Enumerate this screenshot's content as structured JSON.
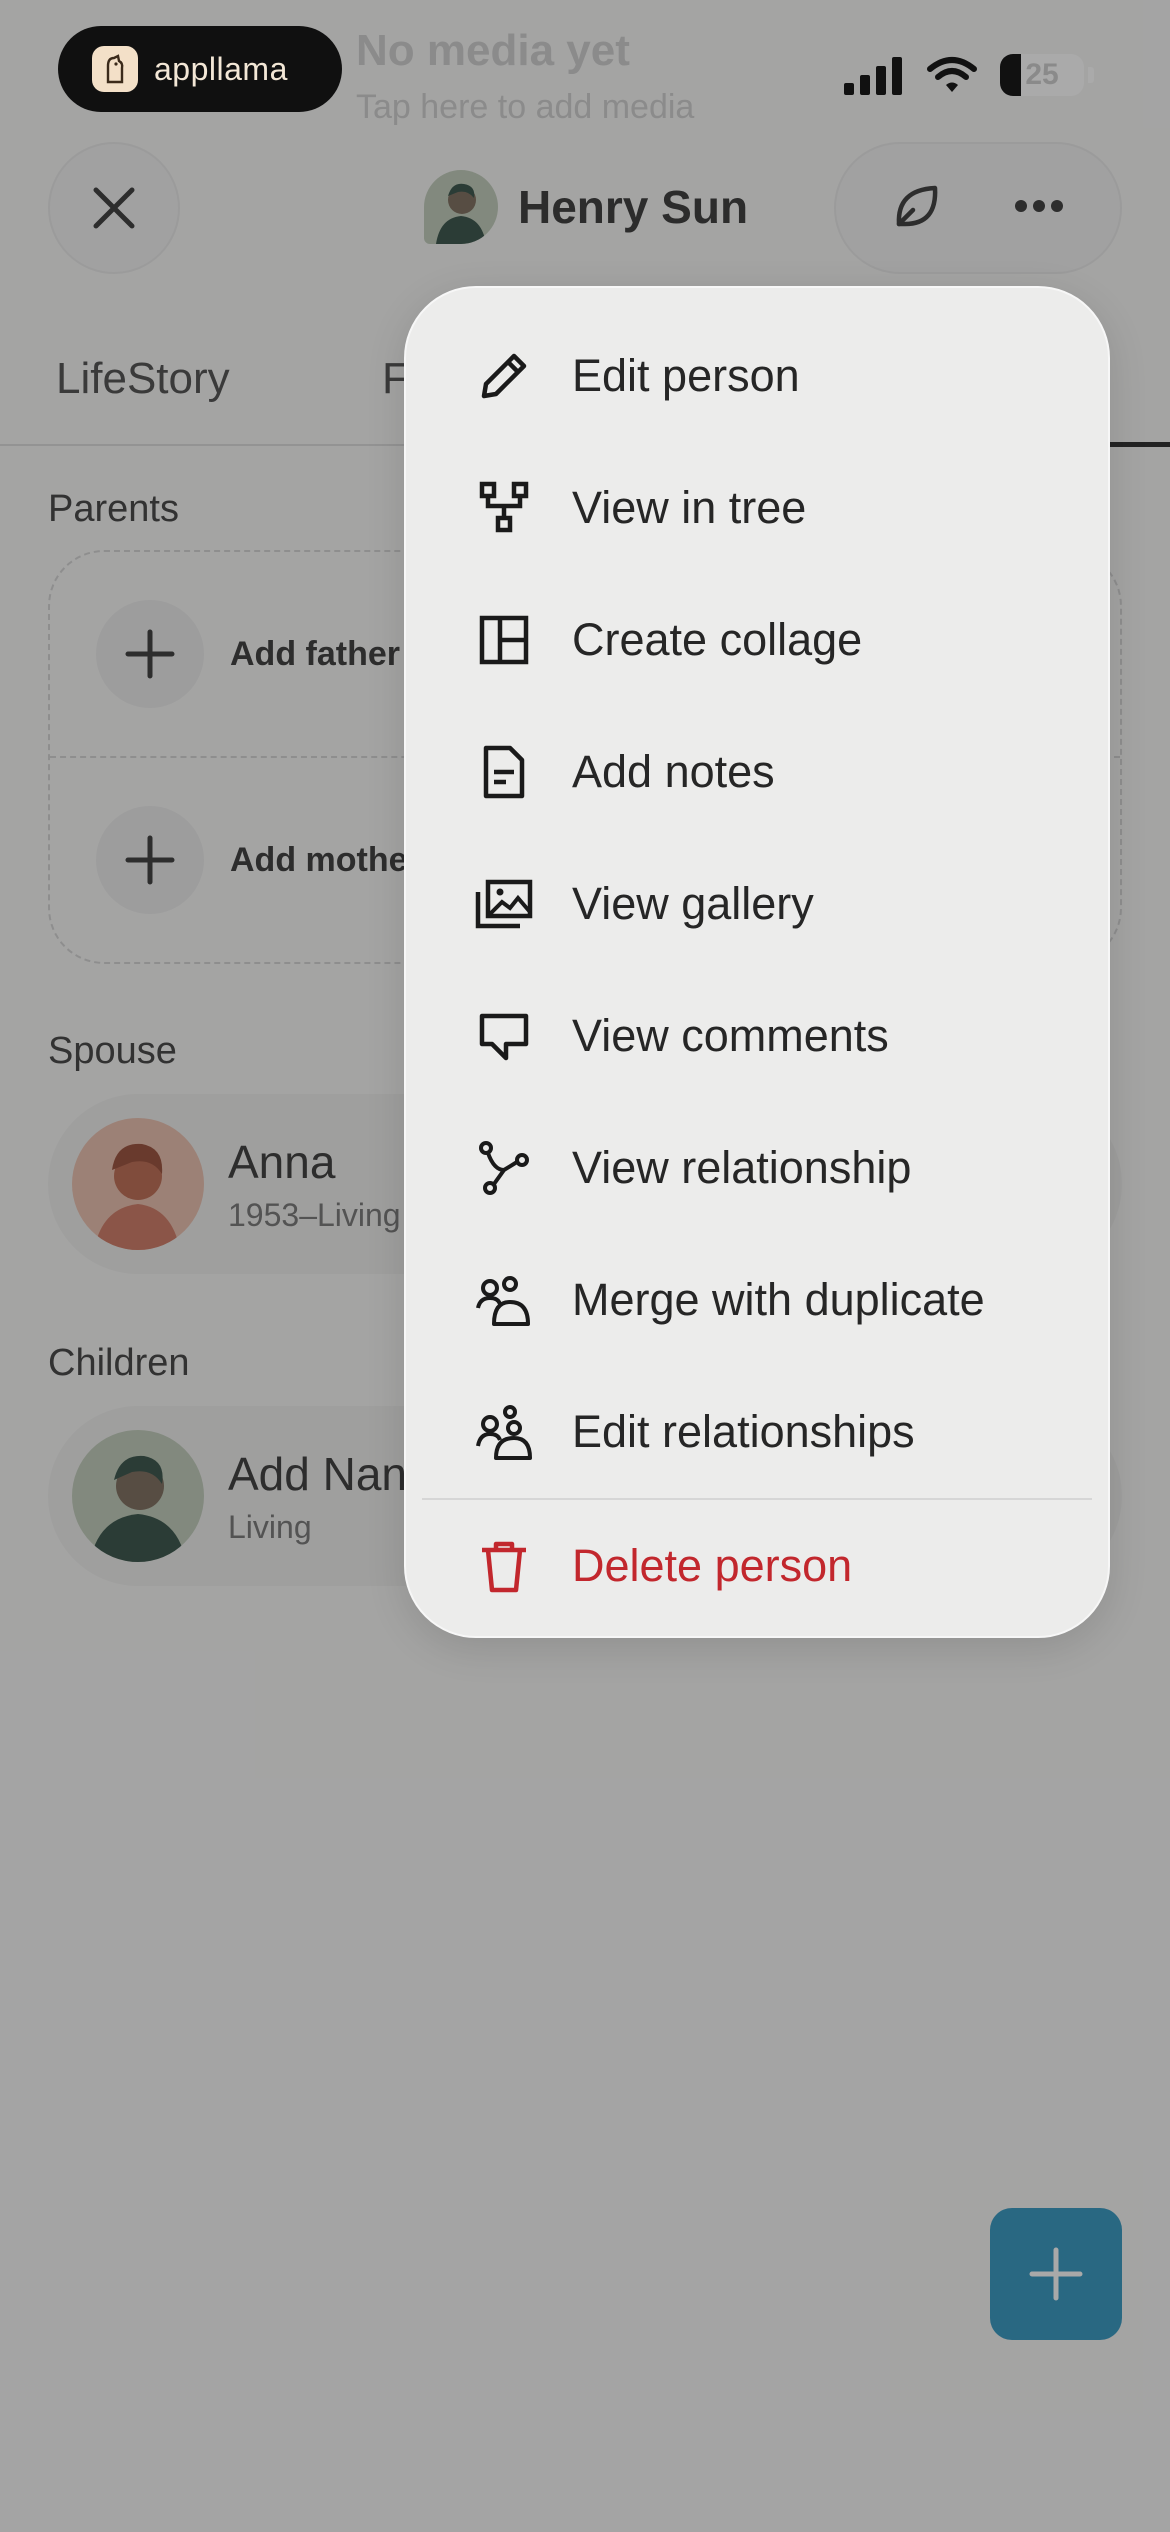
{
  "background": {
    "ghost_title": "No media yet",
    "ghost_subtitle": "Tap here to add media"
  },
  "status_bar": {
    "brand": "appllama",
    "battery_percent": "25",
    "battery_level": 0.25
  },
  "header": {
    "person_name": "Henry Sun",
    "close_icon": "close-icon",
    "actions": [
      "leaf-icon",
      "more-icon"
    ]
  },
  "tabs": [
    {
      "label": "LifeStory"
    },
    {
      "label": "F"
    }
  ],
  "parents": {
    "label": "Parents",
    "add_father": "Add father",
    "add_mother": "Add mother"
  },
  "spouse": {
    "label": "Spouse",
    "name": "Anna",
    "dates": "1953–Living"
  },
  "children": {
    "label": "Children",
    "name": "Add Nan",
    "dates": "Living"
  },
  "menu": {
    "items": [
      {
        "label": "Edit person",
        "icon": "pencil-icon"
      },
      {
        "label": "View in tree",
        "icon": "tree-icon"
      },
      {
        "label": "Create collage",
        "icon": "collage-icon"
      },
      {
        "label": "Add notes",
        "icon": "notes-icon"
      },
      {
        "label": "View gallery",
        "icon": "gallery-icon"
      },
      {
        "label": "View comments",
        "icon": "comment-icon"
      },
      {
        "label": "View relationship",
        "icon": "relationship-icon"
      },
      {
        "label": "Merge with duplicate",
        "icon": "people-icon"
      },
      {
        "label": "Edit relationships",
        "icon": "people-icon"
      }
    ],
    "delete": {
      "label": "Delete person",
      "icon": "trash-icon",
      "color": "#c2272d"
    }
  },
  "colors": {
    "fab": "#1c8cba",
    "danger": "#c2272d"
  }
}
